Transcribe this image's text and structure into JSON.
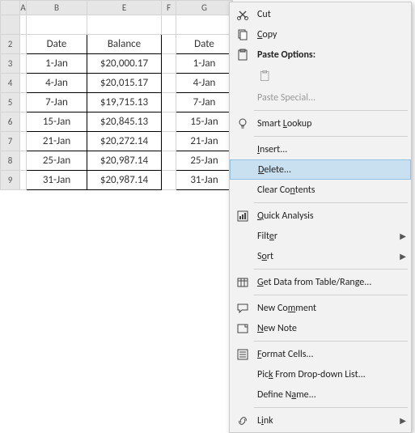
{
  "columns": [
    "A",
    "B",
    "E",
    "F",
    "G"
  ],
  "rows": [
    "2",
    "3",
    "4",
    "5",
    "6",
    "7",
    "8",
    "9"
  ],
  "table1": {
    "h_date": "Date",
    "h_balance": "Balance",
    "data": [
      {
        "date": "1-Jan",
        "bal": "$20,000.17"
      },
      {
        "date": "4-Jan",
        "bal": "$20,015.17"
      },
      {
        "date": "7-Jan",
        "bal": "$19,715.13"
      },
      {
        "date": "15-Jan",
        "bal": "$20,845.13"
      },
      {
        "date": "21-Jan",
        "bal": "$20,272.14"
      },
      {
        "date": "25-Jan",
        "bal": "$20,987.14"
      },
      {
        "date": "31-Jan",
        "bal": "$20,987.14"
      }
    ]
  },
  "table2": {
    "h_date": "Date",
    "data": [
      {
        "date": "1-Jan"
      },
      {
        "date": "4-Jan"
      },
      {
        "date": "7-Jan"
      },
      {
        "date": "15-Jan"
      },
      {
        "date": "21-Jan"
      },
      {
        "date": "25-Jan"
      },
      {
        "date": "31-Jan"
      }
    ]
  },
  "menu": {
    "cut": "Cut",
    "copy": "Copy",
    "paste_options": "Paste Options:",
    "paste_special": "Paste Special...",
    "smart_lookup": "Smart Lookup",
    "insert": "Insert...",
    "delete": "Delete...",
    "clear": "Clear Contents",
    "quick": "Quick Analysis",
    "filter": "Filter",
    "sort": "Sort",
    "getdata": "Get Data from Table/Range...",
    "newcomment": "New Comment",
    "newnote": "New Note",
    "formatcells": "Format Cells...",
    "pickdrop": "Pick From Drop-down List...",
    "definename": "Define Name...",
    "link": "Link"
  }
}
